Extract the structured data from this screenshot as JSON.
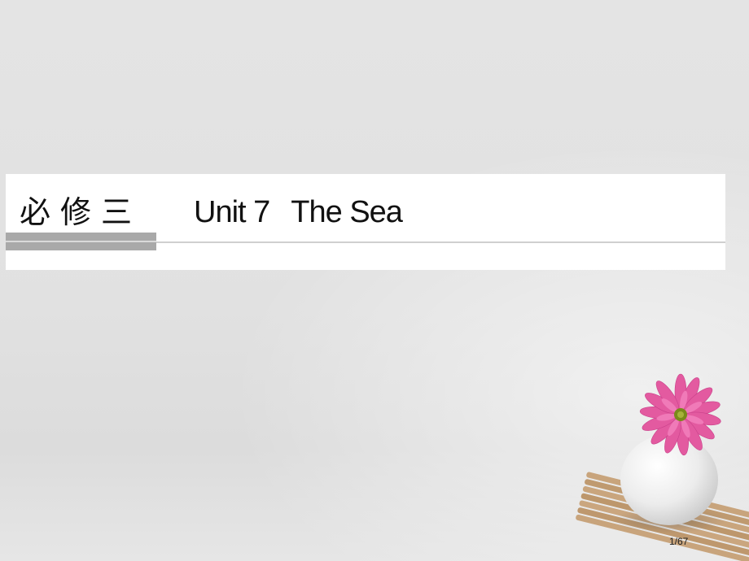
{
  "slide": {
    "book_label": "必修三",
    "unit_label": "Unit 7",
    "unit_subtitle": "The Sea",
    "page_indicator": "1/67"
  },
  "colors": {
    "background": "#e2e2e2",
    "band": "#ffffff",
    "accent_bar": "#a9a9a9",
    "flower": "#e0559c",
    "flower_center": "#7a8a1a",
    "vase": "#f4f4f4",
    "mat": "#c7a27a",
    "text": "#111111"
  },
  "decor": {
    "image_name": "flower-vase-image"
  }
}
